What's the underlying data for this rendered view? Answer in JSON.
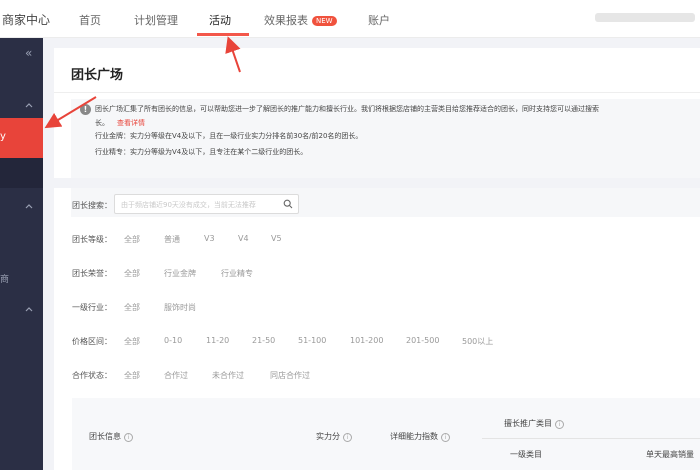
{
  "header": {
    "brand": "商家中心",
    "nav": [
      {
        "label": "首页"
      },
      {
        "label": "计划管理"
      },
      {
        "label": "活动"
      },
      {
        "label": "效果报表",
        "badge": "NEW"
      },
      {
        "label": "账户"
      }
    ]
  },
  "sidebar": {
    "collapse_glyph": "«",
    "active_item_fragment": "y",
    "side_fragment": "商"
  },
  "panel": {
    "title": "团长广场",
    "notice": {
      "line1": "团长广场汇集了所有团长的信息，可以帮助您进一步了解团长的推广能力和擅长行业。我们将根据您店铺的主营类目给您推荐适合的团长，同时支持您可以通过搜索",
      "line2_prefix": "长。",
      "link": "查看详情",
      "line3": "行业金牌：实力分等级在V4及以下，且在一级行业实力分排名前30名/前20名的团长。",
      "line4": "行业精专：实力分等级为V4及以下，且专注在某个二级行业的团长。"
    },
    "filters": {
      "search": {
        "label": "团长搜索：",
        "placeholder": "由于频店铺近90天没有成交，当前无法推荐"
      },
      "level": {
        "label": "团长等级：",
        "options": [
          "全部",
          "普通",
          "V3",
          "V4",
          "V5"
        ]
      },
      "honor": {
        "label": "团长荣誉：",
        "options": [
          "全部",
          "行业金牌",
          "行业精专"
        ]
      },
      "industry": {
        "label": "一级行业：",
        "options": [
          "全部",
          "服饰时尚"
        ]
      },
      "price": {
        "label": "价格区间：",
        "options": [
          "全部",
          "0-10",
          "11-20",
          "21-50",
          "51-100",
          "101-200",
          "201-500",
          "500以上"
        ]
      },
      "coop": {
        "label": "合作状态：",
        "options": [
          "全部",
          "合作过",
          "未合作过",
          "同店合作过"
        ]
      }
    },
    "table": {
      "col_info": "团长信息",
      "col_score": "实力分",
      "col_ability": "详细能力指数",
      "col_category": "擅长推广类目",
      "sub_col_level1": "一级类目",
      "sub_col_sales": "单天最高销量"
    }
  },
  "colors": {
    "accent": "#e8443a",
    "sidebar_bg": "#2b2f45",
    "badge": "#f0523d"
  },
  "icons": [
    "collapse-icon",
    "chevron-up-icon",
    "info-icon",
    "search-icon",
    "help-icon",
    "annotation-arrow"
  ]
}
